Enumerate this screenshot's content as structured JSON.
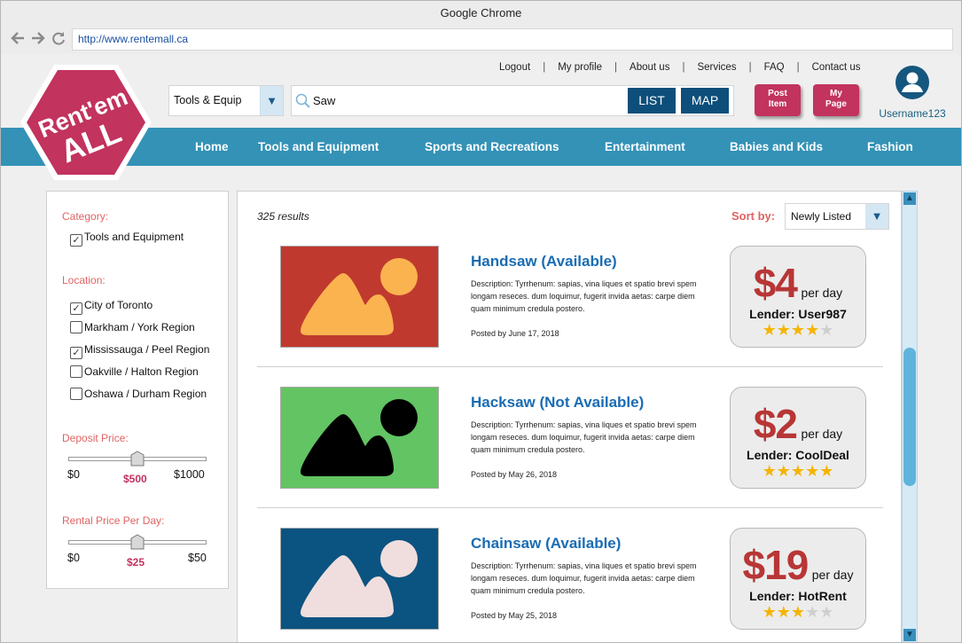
{
  "browser": {
    "title": "Google Chrome",
    "url": "http://www.rentemall.ca"
  },
  "logo": {
    "line1": "Rent'em",
    "line2": "ALL",
    "color": "#c2335e"
  },
  "top_links": [
    "Logout",
    "My profile",
    "About us",
    "Services",
    "FAQ",
    "Contact us"
  ],
  "search": {
    "category": "Tools & Equip",
    "query": "Saw",
    "list_label": "LIST",
    "map_label": "MAP"
  },
  "actions": {
    "post_item": [
      "Post",
      "Item"
    ],
    "my_page": [
      "My",
      "Page"
    ]
  },
  "user": {
    "name": "Username123"
  },
  "menu": [
    "Home",
    "Tools and Equipment",
    "Sports and Recreations",
    "Entertainment",
    "Babies and Kids",
    "Fashion"
  ],
  "filters": {
    "category_label": "Category:",
    "category_items": [
      {
        "label": "Tools and Equipment",
        "checked": true
      }
    ],
    "location_label": "Location:",
    "location_items": [
      {
        "label": "City of Toronto",
        "checked": true
      },
      {
        "label": "Markham / York Region",
        "checked": false
      },
      {
        "label": "Mississauga / Peel Region",
        "checked": true
      },
      {
        "label": "Oakville / Halton Region",
        "checked": false
      },
      {
        "label": "Oshawa / Durham Region",
        "checked": false
      }
    ],
    "deposit": {
      "label": "Deposit Price:",
      "min": "$0",
      "value": "$500",
      "max": "$1000"
    },
    "rental": {
      "label": "Rental Price Per Day:",
      "min": "$0",
      "value": "$25",
      "max": "$50"
    }
  },
  "results": {
    "count_text": "325 results",
    "sort_label": "Sort by:",
    "sort_value": "Newly Listed",
    "items": [
      {
        "title": "Handsaw (Available)",
        "description": "Description: Tyrrhenum: sapias, vina liques et spatio brevi spem longam reseces. dum loquimur, fugerit invida aetas: carpe diem quam minimum credula postero.",
        "posted": "Posted by June 17, 2018",
        "price": "$4",
        "per": "per day",
        "lender": "Lender: User987",
        "rating": 4,
        "image_colors": {
          "bg": "#c0392f",
          "shape": "#fbb34f"
        }
      },
      {
        "title": "Hacksaw (Not Available)",
        "description": "Description: Tyrrhenum: sapias, vina liques et spatio brevi spem longam reseces. dum loquimur, fugerit invida aetas: carpe diem quam minimum credula postero.",
        "posted": "Posted by May 26, 2018",
        "price": "$2",
        "per": "per day",
        "lender": "Lender: CoolDeal",
        "rating": 5,
        "image_colors": {
          "bg": "#63c463",
          "shape": "#000000"
        }
      },
      {
        "title": "Chainsaw (Available)",
        "description": "Description: Tyrrhenum: sapias, vina liques et spatio brevi spem longam reseces. dum loquimur, fugerit invida aetas: carpe diem quam minimum credula postero.",
        "posted": "Posted by May 25, 2018",
        "price": "$19",
        "per": "per day",
        "lender": "Lender: HotRent",
        "rating": 3,
        "image_colors": {
          "bg": "#0b5380",
          "shape": "#f0dede"
        }
      }
    ]
  },
  "icons": {
    "back": "back-arrow-icon",
    "forward": "forward-arrow-icon",
    "reload": "reload-icon",
    "search": "search-icon",
    "user": "user-avatar-icon",
    "dropdown": "chevron-down-icon",
    "star": "star-icon"
  }
}
